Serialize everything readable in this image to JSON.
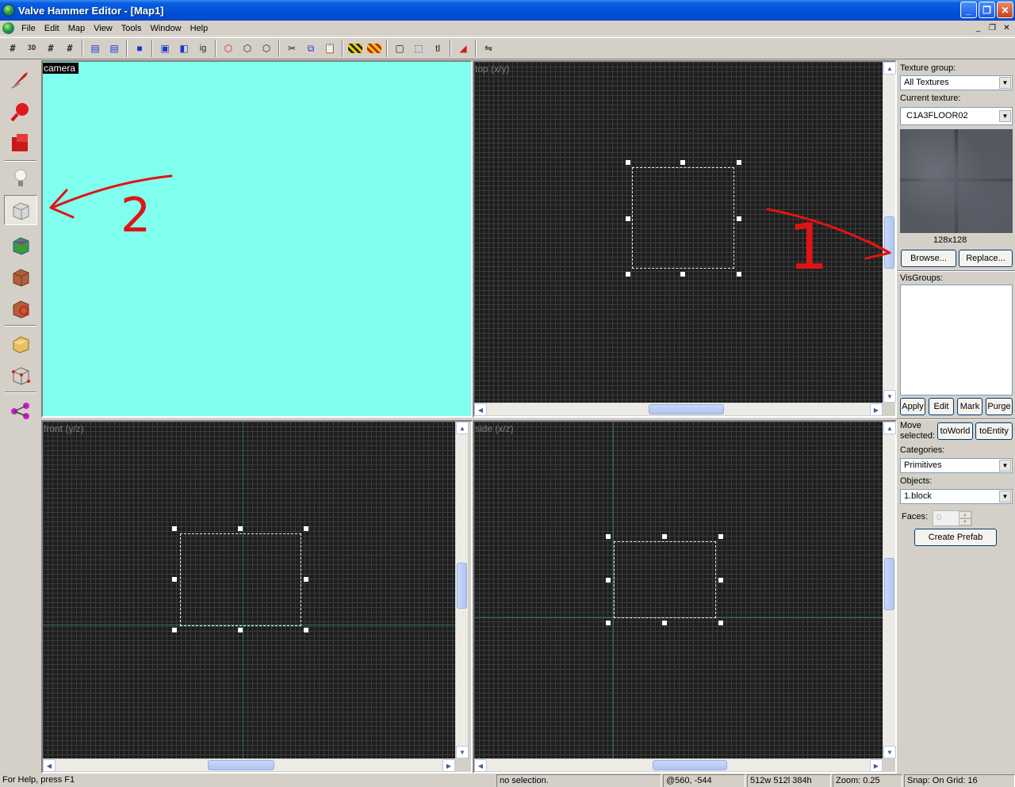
{
  "window": {
    "title": "Valve Hammer Editor - [Map1]"
  },
  "menu": [
    "File",
    "Edit",
    "Map",
    "View",
    "Tools",
    "Window",
    "Help"
  ],
  "toolbar": {
    "text_button": "tl"
  },
  "viewports": {
    "camera": {
      "label": "camera",
      "background": "#80ffee"
    },
    "top": {
      "label": "top (x/y)"
    },
    "front": {
      "label": "front (y/z)"
    },
    "side": {
      "label": "side (x/z)"
    }
  },
  "texture_panel": {
    "group_label": "Texture group:",
    "group_value": "All Textures",
    "current_label": "Current texture:",
    "current_value": "C1A3FLOOR02",
    "size": "128x128",
    "browse": "Browse...",
    "replace": "Replace..."
  },
  "visgroups": {
    "label": "VisGroups:",
    "apply": "Apply",
    "edit": "Edit",
    "mark": "Mark",
    "purge": "Purge"
  },
  "object_panel": {
    "move_label": "Move selected:",
    "to_world": "toWorld",
    "to_entity": "toEntity",
    "categories_label": "Categories:",
    "categories_value": "Primitives",
    "objects_label": "Objects:",
    "objects_value": "1.block",
    "faces_label": "Faces:",
    "faces_value": "0",
    "create_prefab": "Create Prefab"
  },
  "annotations": {
    "arrow_1": "1",
    "arrow_2": "2"
  },
  "status": {
    "help": "For Help, press F1",
    "selection": "no selection.",
    "coords": "@560, -544",
    "dims": "512w 512l 384h",
    "zoom": "Zoom: 0.25",
    "snap": "Snap: On Grid: 16"
  }
}
